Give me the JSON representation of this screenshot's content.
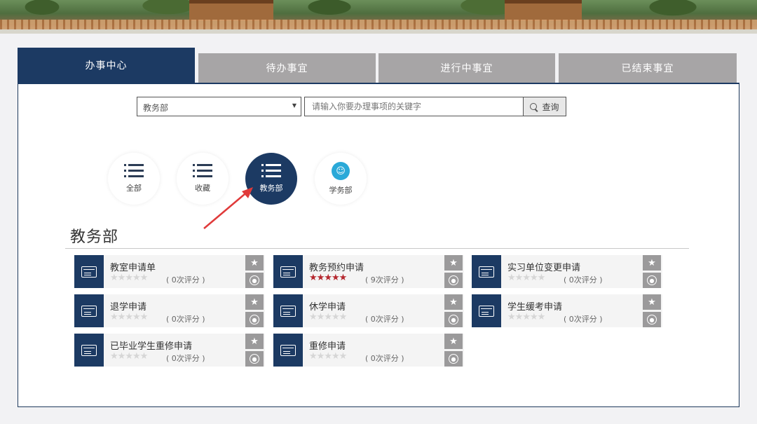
{
  "tabs": [
    {
      "label": "办事中心",
      "active": true
    },
    {
      "label": "待办事宜",
      "active": false
    },
    {
      "label": "进行中事宜",
      "active": false
    },
    {
      "label": "已结束事宜",
      "active": false
    }
  ],
  "search": {
    "department_value": "教务部",
    "placeholder": "请输入你要办理事项的关键字",
    "button_label": "查询"
  },
  "categories": [
    {
      "label": "全部",
      "icon": "list-icon",
      "active": false
    },
    {
      "label": "收藏",
      "icon": "list-icon",
      "active": false
    },
    {
      "label": "教务部",
      "icon": "list-icon",
      "active": true
    },
    {
      "label": "学务部",
      "icon": "student-affairs-icon",
      "active": false
    }
  ],
  "section": {
    "title": "教务部"
  },
  "items": [
    {
      "name": "教室申请单",
      "rating": 0,
      "count_text": "( 0次评分 )"
    },
    {
      "name": "教务预约申请",
      "rating": 5,
      "count_text": "( 9次评分 )"
    },
    {
      "name": "实习单位变更申请",
      "rating": 0,
      "count_text": "( 0次评分 )"
    },
    {
      "name": "退学申请",
      "rating": 0,
      "count_text": "( 0次评分 )"
    },
    {
      "name": "休学申请",
      "rating": 0,
      "count_text": "( 0次评分 )"
    },
    {
      "name": "学生缓考申请",
      "rating": 0,
      "count_text": "( 0次评分 )"
    },
    {
      "name": "已毕业学生重修申请",
      "rating": 0,
      "count_text": "( 0次评分 )"
    },
    {
      "name": "重修申请",
      "rating": 0,
      "count_text": "( 0次评分 )"
    }
  ],
  "colors": {
    "primary": "#1c3a63",
    "tab_inactive": "#a7a5a6",
    "star_active": "#b5272e",
    "annotation_arrow": "#e03a3a"
  }
}
